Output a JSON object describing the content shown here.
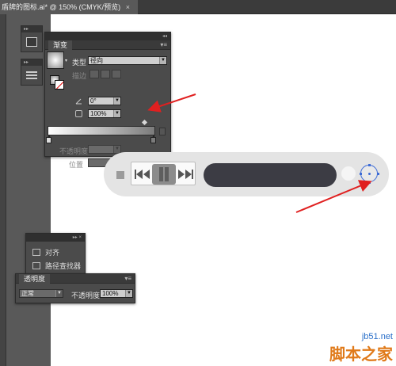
{
  "document": {
    "tab_title": "盾牌的图标.ai* @ 150% (CMYK/预览)",
    "close_glyph": "×"
  },
  "gradient_panel": {
    "collapse_glyph": "◂◂",
    "tab_label": "渐变",
    "menu_glyph": "▾≡",
    "type_label": "类型",
    "type_value": "径向",
    "stroke_label": "描边",
    "angle_value": "0°",
    "aspect_value": "100%",
    "opacity_label": "不透明度",
    "location_label": "位置"
  },
  "player": {
    "prev_label": "◂◂",
    "next_label": "▸▸"
  },
  "align_panel": {
    "title_glyph": "▸▸ ×",
    "align_label": "对齐",
    "pathfinder_label": "路径查找器"
  },
  "transparency_panel": {
    "tab_label": "透明度",
    "mode_value": "正常",
    "opacity_label": "不透明度",
    "opacity_value": "100%"
  },
  "watermark": {
    "url": "jb51.net",
    "name": "脚本之家"
  },
  "colors": {
    "annotation_arrow": "#e02020",
    "selection": "#3d6bd6"
  }
}
